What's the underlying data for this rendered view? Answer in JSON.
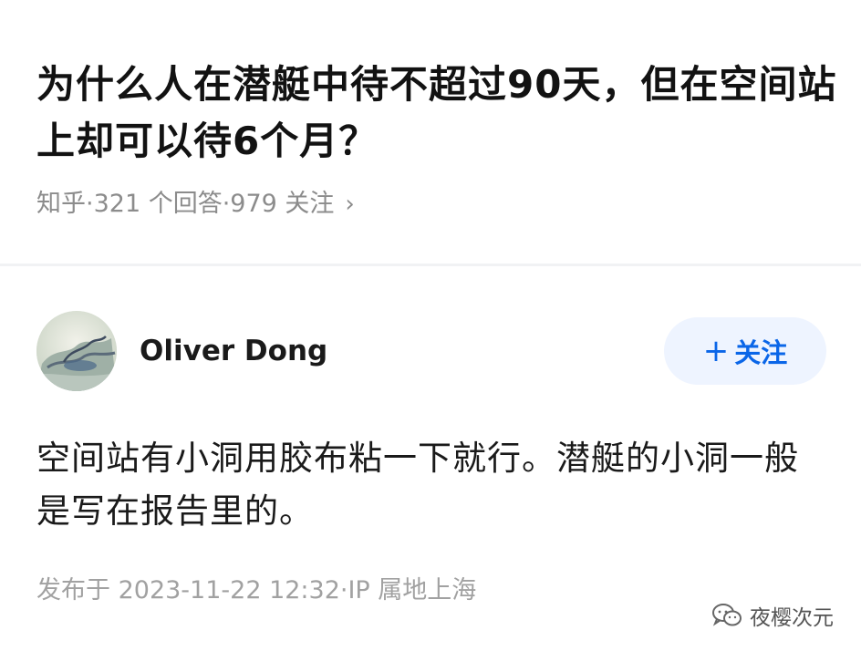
{
  "question": {
    "title": "为什么人在潜艇中待不超过90天，但在空间站上却可以待6个月？",
    "meta": "知乎·321 个回答·979 关注",
    "meta_chevron": "›"
  },
  "answer": {
    "author_name": "Oliver Dong",
    "follow_label": "关注",
    "follow_plus": "+",
    "content": "空间站有小洞用胶布粘一下就行。潜艇的小洞一般是写在报告里的。",
    "published": "发布于 2023-11-22 12:32·IP 属地上海"
  },
  "watermark": {
    "text": "夜樱次元",
    "icon": "wechat-icon"
  },
  "colors": {
    "follow_text": "#0a66e8",
    "follow_bg": "#eef4ff",
    "meta_gray": "#8c8c8c"
  }
}
